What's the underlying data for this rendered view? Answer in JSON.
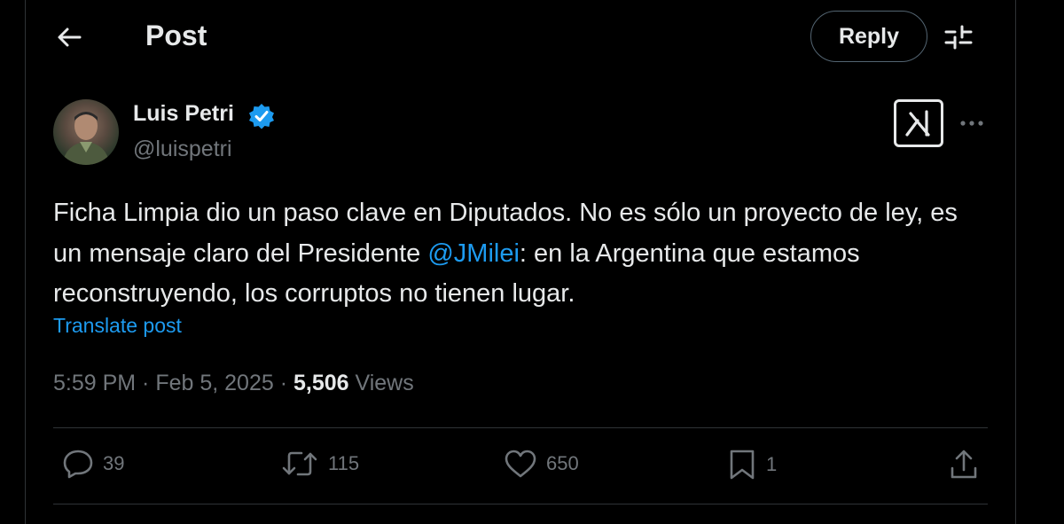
{
  "header": {
    "title": "Post",
    "reply_label": "Reply"
  },
  "post": {
    "author_name": "Luis Petri",
    "author_handle": "@luispetri",
    "text_part1": "Ficha Limpia dio un paso clave en Diputados. No es sólo un proyecto de ley, es un mensaje claro del Presidente ",
    "mention": "@JMilei",
    "text_part2": ": en la Argentina que estamos reconstruyendo, los corruptos no tienen lugar.",
    "translate_label": "Translate post",
    "time": "5:59 PM",
    "date": "Feb 5, 2025",
    "separator": " · ",
    "views_count": "5,506",
    "views_label": "Views"
  },
  "actions": {
    "replies": "39",
    "reposts": "115",
    "likes": "650",
    "bookmarks": "1"
  },
  "icons": {
    "back": "arrow-left-icon",
    "settings": "sliders-icon",
    "verified": "verified-badge-icon",
    "grok": "grok-icon",
    "more": "more-horizontal-icon",
    "reply": "reply-icon",
    "repost": "repost-icon",
    "like": "heart-icon",
    "bookmark": "bookmark-icon",
    "share": "share-icon"
  },
  "colors": {
    "background": "#000000",
    "text": "#e7e9ea",
    "secondary": "#71767b",
    "accent": "#1d9bf0",
    "border": "#2f3336"
  }
}
